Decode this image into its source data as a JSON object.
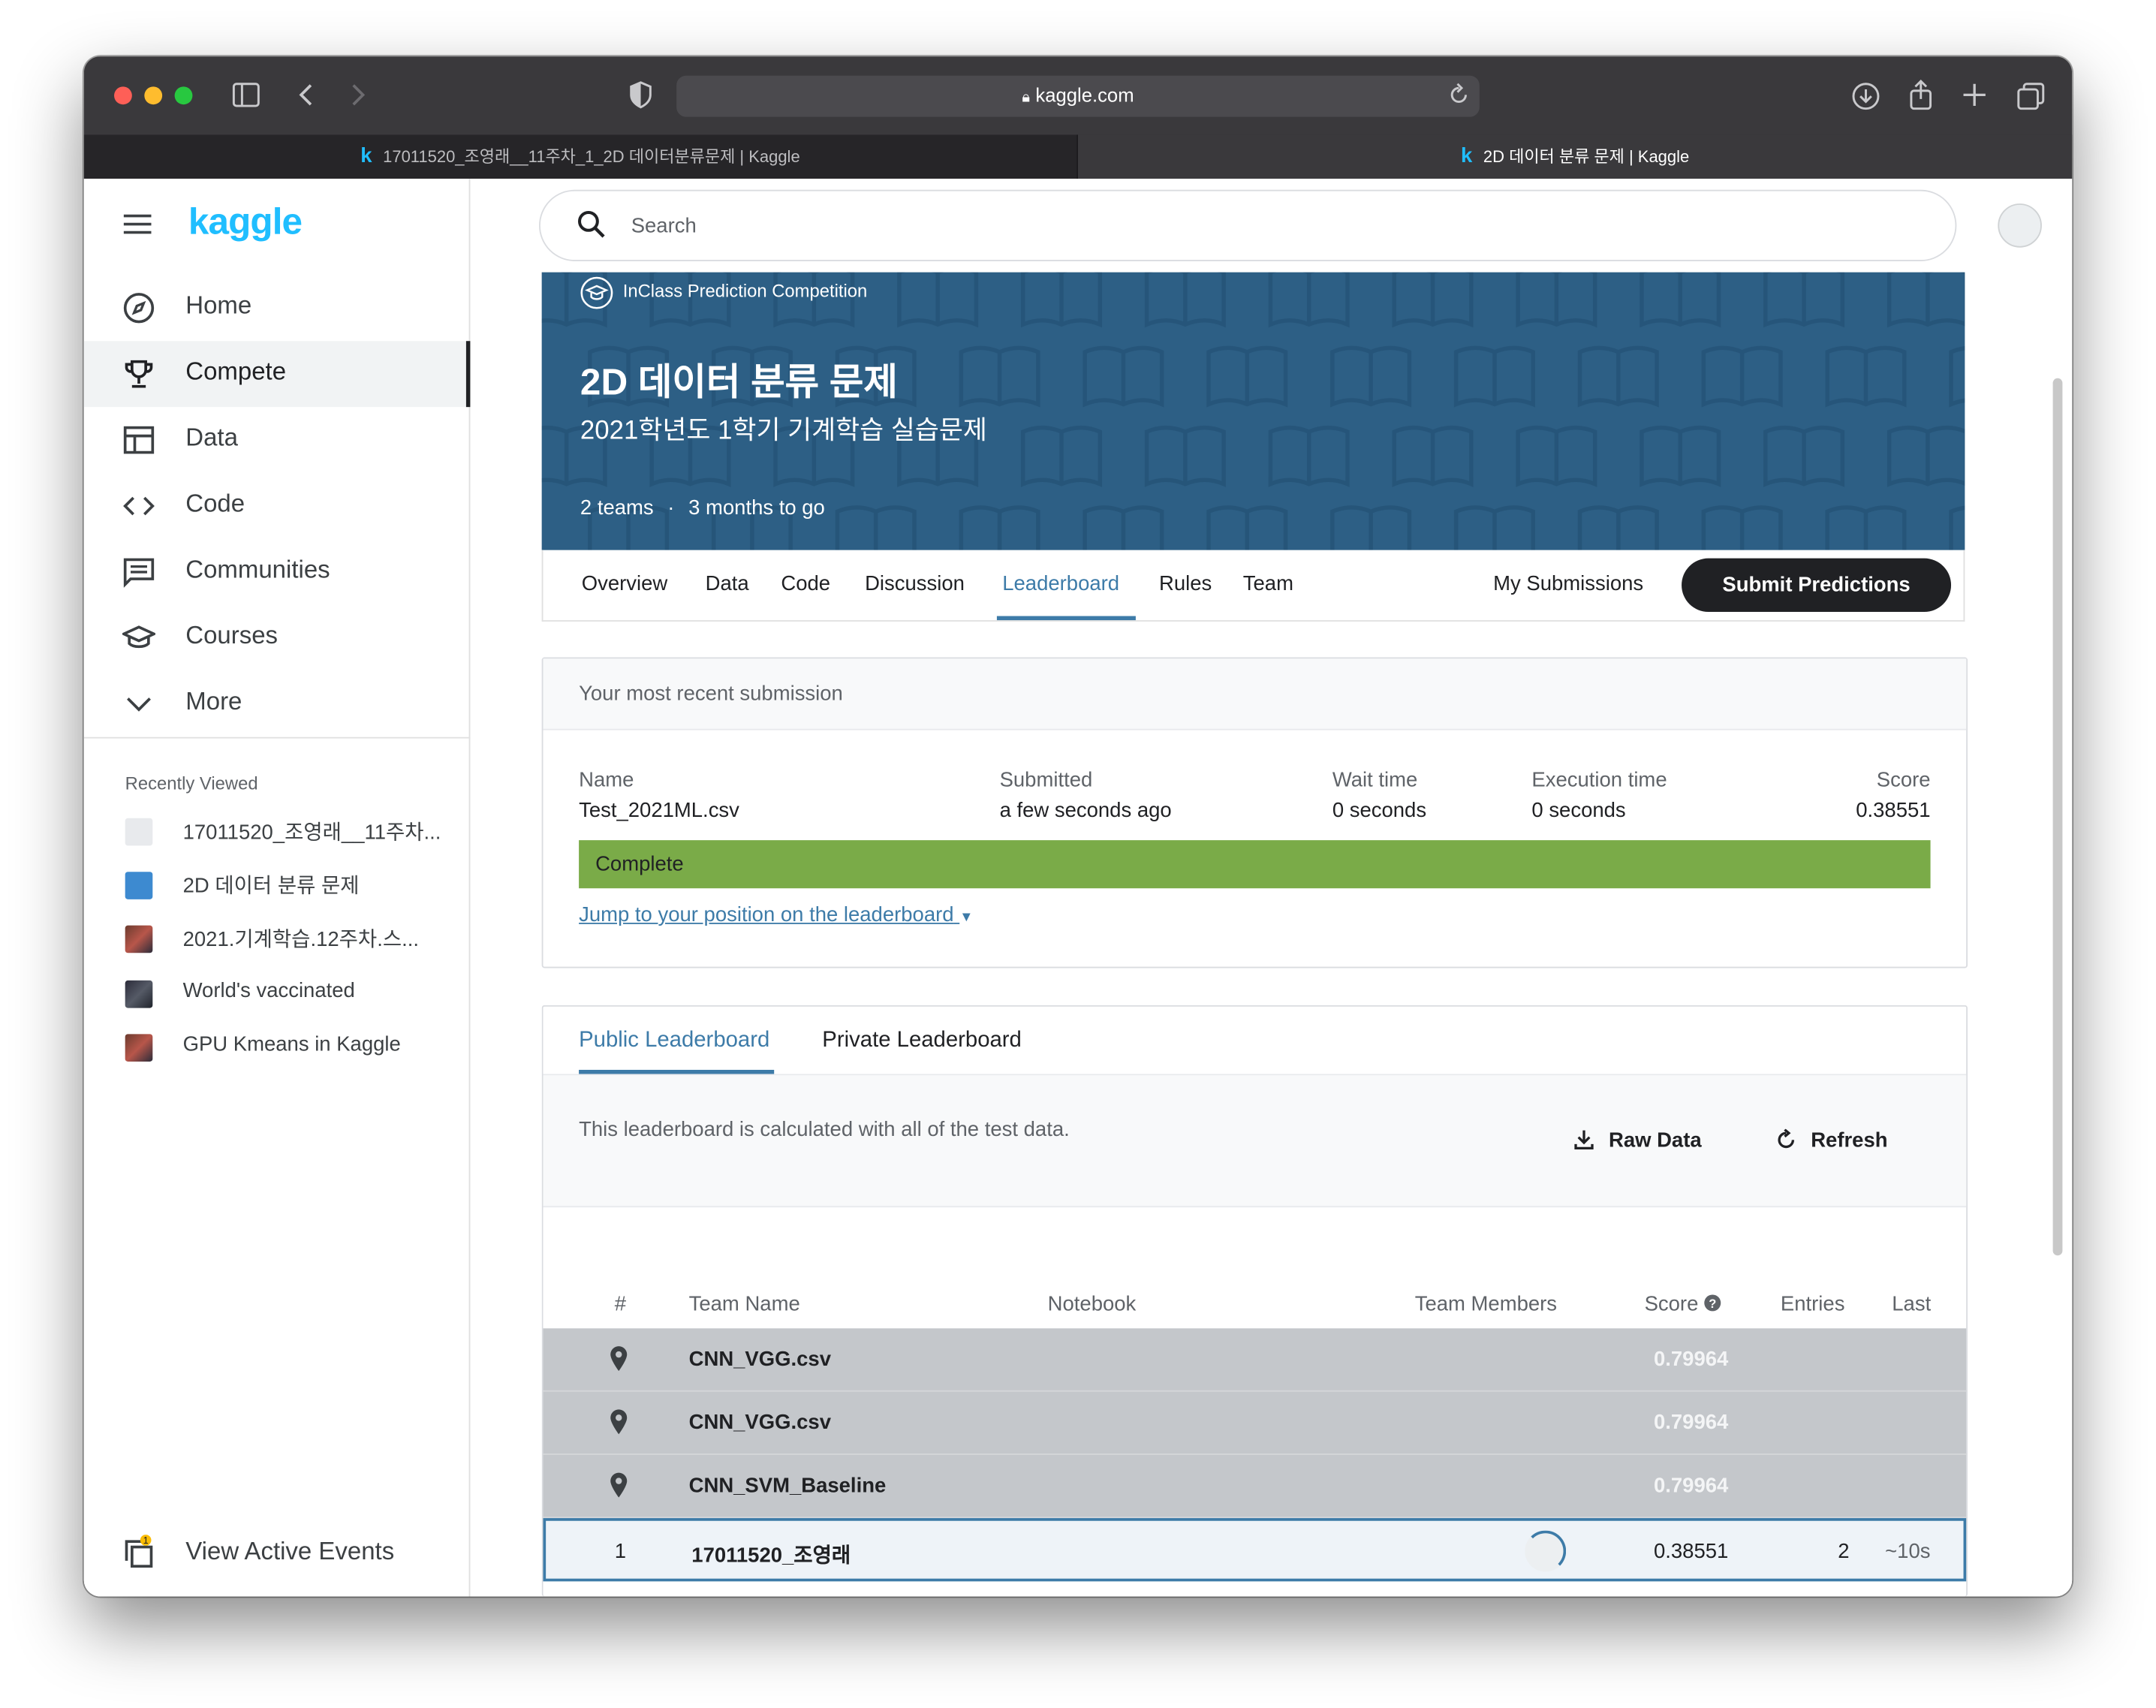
{
  "browser": {
    "url": "kaggle.com",
    "tabs": [
      {
        "label": "17011520_조영래__11주차_1_2D 데이터분류문제 | Kaggle",
        "active": false
      },
      {
        "label": "2D 데이터 분류 문제 | Kaggle",
        "active": true
      }
    ]
  },
  "sidebar": {
    "logo": "kaggle",
    "nav": [
      {
        "label": "Home",
        "icon": "compass-icon"
      },
      {
        "label": "Compete",
        "icon": "trophy-icon",
        "active": true
      },
      {
        "label": "Data",
        "icon": "table-icon"
      },
      {
        "label": "Code",
        "icon": "code-icon"
      },
      {
        "label": "Communities",
        "icon": "comment-icon"
      },
      {
        "label": "Courses",
        "icon": "graduation-cap-icon"
      },
      {
        "label": "More",
        "icon": "chevron-down-icon"
      }
    ],
    "recently_viewed_title": "Recently Viewed",
    "recently_viewed": [
      {
        "label": "17011520_조영래__11주차..."
      },
      {
        "label": "2D 데이터 분류 문제"
      },
      {
        "label": "2021.기계학습.12주차.스..."
      },
      {
        "label": "World's vaccinated"
      },
      {
        "label": "GPU Kmeans in Kaggle"
      }
    ],
    "events_label": "View Active Events",
    "events_badge": "1"
  },
  "search": {
    "placeholder": "Search"
  },
  "competition": {
    "kind": "InClass Prediction Competition",
    "title": "2D 데이터 분류 문제",
    "subtitle": "2021학년도 1학기 기계학습 실습문제",
    "teams": "2 teams",
    "separator": "·",
    "deadline": "3 months to go",
    "tabs": [
      "Overview",
      "Data",
      "Code",
      "Discussion",
      "Leaderboard",
      "Rules",
      "Team"
    ],
    "active_tab": "Leaderboard",
    "my_submissions": "My Submissions",
    "submit_button": "Submit Predictions"
  },
  "recent_submission": {
    "header": "Your most recent submission",
    "columns": {
      "name": "Name",
      "submitted": "Submitted",
      "wait": "Wait time",
      "execution": "Execution time",
      "score": "Score"
    },
    "values": {
      "name": "Test_2021ML.csv",
      "submitted": "a few seconds ago",
      "wait": "0 seconds",
      "execution": "0 seconds",
      "score": "0.38551"
    },
    "status": "Complete",
    "status_color": "#7aab48",
    "jump_link": "Jump to your position on the leaderboard"
  },
  "leaderboard": {
    "tabs": [
      "Public Leaderboard",
      "Private Leaderboard"
    ],
    "active_tab": "Public Leaderboard",
    "description": "This leaderboard is calculated with all of the test data.",
    "raw_data": "Raw Data",
    "refresh": "Refresh",
    "columns": {
      "rank": "#",
      "team": "Team Name",
      "notebook": "Notebook",
      "members": "Team Members",
      "score": "Score",
      "entries": "Entries",
      "last": "Last"
    },
    "benchmarks": [
      {
        "name": "CNN_VGG.csv",
        "score": "0.79964"
      },
      {
        "name": "CNN_VGG.csv",
        "score": "0.79964"
      },
      {
        "name": "CNN_SVM_Baseline",
        "score": "0.79964"
      }
    ],
    "my_row": {
      "rank": "1",
      "name": "17011520_조영래",
      "score": "0.38551",
      "entries": "2",
      "last": "~10s"
    }
  },
  "colors": {
    "accent": "#3d7ba8",
    "brand": "#20beff",
    "banner": "#2d5f85"
  }
}
